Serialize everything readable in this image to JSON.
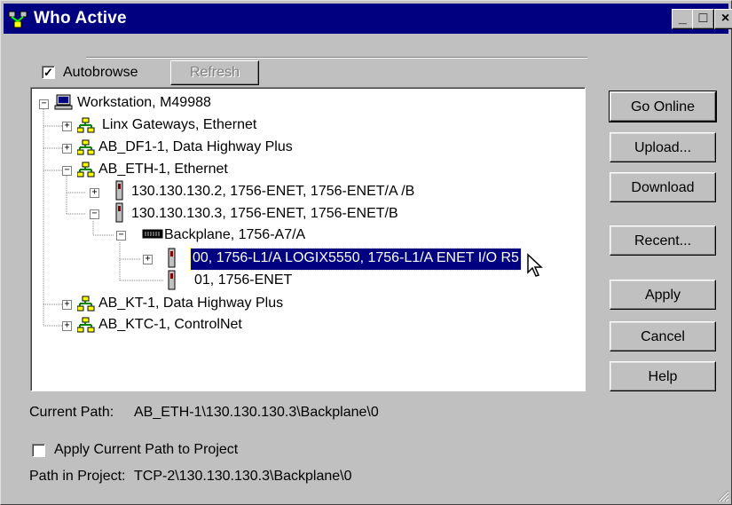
{
  "window": {
    "title": "Who Active",
    "controls": {
      "minimize": "_",
      "maximize": "□",
      "close": "×"
    }
  },
  "toolbar": {
    "autobrowse_label": "Autobrowse",
    "autobrowse_checked": true,
    "refresh_label": "Refresh"
  },
  "tree": {
    "items": [
      {
        "label": "Workstation, M49988",
        "icon": "workstation-icon",
        "expander": "−"
      },
      {
        "label": "Linx Gateways, Ethernet",
        "icon": "network-icon",
        "expander": "+"
      },
      {
        "label": "AB_DF1-1, Data Highway Plus",
        "icon": "network-icon",
        "expander": "+"
      },
      {
        "label": "AB_ETH-1, Ethernet",
        "icon": "network-icon",
        "expander": "−"
      },
      {
        "label": "130.130.130.2, 1756-ENET, 1756-ENET/A /B",
        "icon": "module-icon",
        "expander": "+"
      },
      {
        "label": "130.130.130.3, 1756-ENET, 1756-ENET/B",
        "icon": "module-icon",
        "expander": "−"
      },
      {
        "label": "Backplane, 1756-A7/A",
        "icon": "backplane-icon",
        "expander": "−"
      },
      {
        "label": "00, 1756-L1/A LOGIX5550, 1756-L1/A ENET I/O R5",
        "icon": "module-icon",
        "expander": "+",
        "selected": true
      },
      {
        "label": "01, 1756-ENET",
        "icon": "module-icon",
        "expander": ""
      },
      {
        "label": "AB_KT-1, Data Highway Plus",
        "icon": "network-icon",
        "expander": "+"
      },
      {
        "label": "AB_KTC-1, ControlNet",
        "icon": "network-icon",
        "expander": "+"
      }
    ]
  },
  "buttons": {
    "go_online": "Go Online",
    "upload": "Upload...",
    "download": "Download",
    "recent": "Recent...",
    "apply": "Apply",
    "cancel": "Cancel",
    "help": "Help"
  },
  "footer": {
    "current_path_label": "Current Path:",
    "current_path_value": "AB_ETH-1\\130.130.130.3\\Backplane\\0",
    "apply_path_label": "Apply Current Path to Project",
    "apply_path_checked": false,
    "path_in_project_label": "Path in Project:",
    "path_in_project_value": "TCP-2\\130.130.130.3\\Backplane\\0"
  },
  "colors": {
    "title_bar": "#000080",
    "face": "#c0c0c0",
    "selection": "#000080"
  }
}
